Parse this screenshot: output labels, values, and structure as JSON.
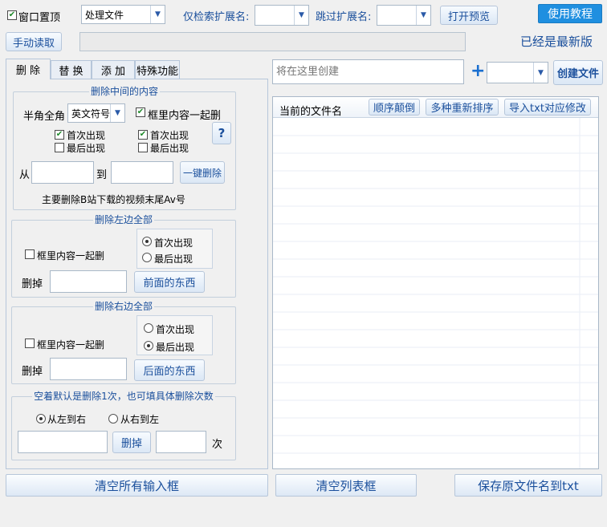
{
  "top": {
    "always_on_top_label": "窗口置顶",
    "always_on_top_checked": true,
    "mode_value": "处理文件",
    "search_ext_label": "仅检索扩展名:",
    "search_ext_value": "",
    "skip_ext_label": "跳过扩展名:",
    "skip_ext_value": "",
    "open_preview_label": "打开预览",
    "tutorial_label": "使用教程",
    "manual_read_label": "手动读取",
    "path_value": "",
    "latest_version_text": "已经是最新版"
  },
  "tabs": [
    {
      "label": "删 除",
      "active": true
    },
    {
      "label": "替 换",
      "active": false
    },
    {
      "label": "添 加",
      "active": false
    },
    {
      "label": "特殊功能",
      "active": false
    }
  ],
  "middle_group": {
    "title": "删除中间的内容",
    "width_label": "半角全角",
    "width_value": "英文符号",
    "include_label": "框里内容一起删",
    "include_checked": true,
    "left_first_label": "首次出现",
    "left_first_checked": true,
    "left_last_label": "最后出现",
    "left_last_checked": false,
    "right_first_label": "首次出现",
    "right_first_checked": true,
    "right_last_label": "最后出现",
    "right_last_checked": false,
    "help_label": "?",
    "from_label": "从",
    "from_value": "",
    "to_label": "到",
    "to_value": "",
    "one_key_delete_label": "一键删除",
    "note_text": "主要删除B站下载的视频末尾Av号"
  },
  "left_group": {
    "title": "删除左边全部",
    "include_label": "框里内容一起删",
    "include_checked": false,
    "first_label": "首次出现",
    "last_label": "最后出现",
    "selected": "first",
    "delete_label": "删掉",
    "delete_value": "",
    "action_label": "前面的东西"
  },
  "right_group": {
    "title": "删除右边全部",
    "include_label": "框里内容一起删",
    "include_checked": false,
    "first_label": "首次出现",
    "last_label": "最后出现",
    "selected": "last",
    "delete_label": "删掉",
    "delete_value": "",
    "action_label": "后面的东西"
  },
  "count_group": {
    "title": "空着默认是删除1次，也可填具体删除次数",
    "ltr_label": "从左到右",
    "rtl_label": "从右到左",
    "selected": "ltr",
    "text_value": "",
    "delete_label": "删掉",
    "count_value": "",
    "times_label": "次"
  },
  "create": {
    "placeholder": "将在这里创建",
    "plus_label": "+",
    "type_value": "",
    "create_file_label": "创建文件"
  },
  "list": {
    "column_header": "当前的文件名",
    "reverse_label": "顺序颠倒",
    "resort_label": "多种重新排序",
    "import_txt_label": "导入txt对应修改",
    "rows": []
  },
  "bottom": {
    "clear_inputs_label": "清空所有输入框",
    "clear_list_label": "清空列表框",
    "save_names_label": "保存原文件名到txt"
  }
}
